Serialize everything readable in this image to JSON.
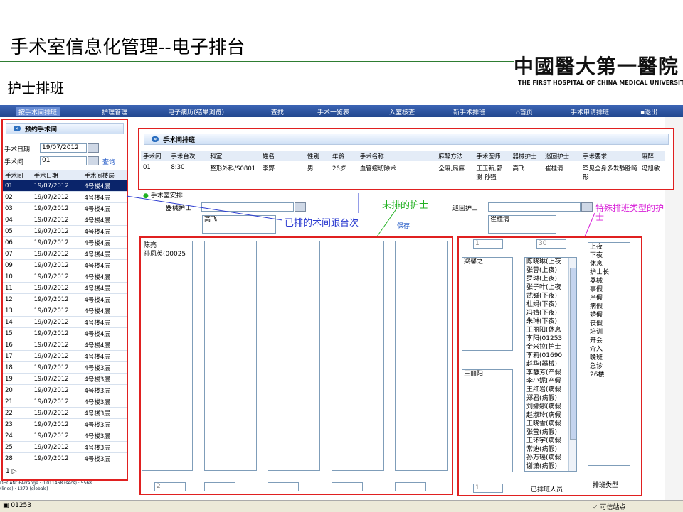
{
  "slide": {
    "title": "手术室信息化管理--电子排台",
    "subtitle": "护士排班",
    "logo_cn": "中國醫大第一醫院",
    "logo_en": "THE FIRST HOSPITAL OF CHINA MEDICAL UNIVERSITY"
  },
  "menu": [
    "按手术间排班",
    "护理管理",
    "电子病历(结果浏览)",
    "查找",
    "手术一览表",
    "入室核查",
    "新手术排班",
    "首页",
    "手术申请排班",
    "退出"
  ],
  "left": {
    "title": "预约手术间",
    "date_label": "手术日期",
    "date_value": "19/07/2012",
    "room_label": "手术间",
    "room_value": "01",
    "query": "查询",
    "headers": [
      "手术间",
      "手术日期",
      "手术间楼层"
    ],
    "rows": [
      [
        "01",
        "19/07/2012",
        "4号楼4层"
      ],
      [
        "02",
        "19/07/2012",
        "4号楼4层"
      ],
      [
        "03",
        "19/07/2012",
        "4号楼4层"
      ],
      [
        "04",
        "19/07/2012",
        "4号楼4层"
      ],
      [
        "05",
        "19/07/2012",
        "4号楼4层"
      ],
      [
        "06",
        "19/07/2012",
        "4号楼4层"
      ],
      [
        "07",
        "19/07/2012",
        "4号楼4层"
      ],
      [
        "09",
        "19/07/2012",
        "4号楼4层"
      ],
      [
        "10",
        "19/07/2012",
        "4号楼4层"
      ],
      [
        "11",
        "19/07/2012",
        "4号楼4层"
      ],
      [
        "12",
        "19/07/2012",
        "4号楼4层"
      ],
      [
        "13",
        "19/07/2012",
        "4号楼4层"
      ],
      [
        "14",
        "19/07/2012",
        "4号楼4层"
      ],
      [
        "15",
        "19/07/2012",
        "4号楼4层"
      ],
      [
        "16",
        "19/07/2012",
        "4号楼4层"
      ],
      [
        "17",
        "19/07/2012",
        "4号楼4层"
      ],
      [
        "18",
        "19/07/2012",
        "4号楼3层"
      ],
      [
        "19",
        "19/07/2012",
        "4号楼3层"
      ],
      [
        "20",
        "19/07/2012",
        "4号楼3层"
      ],
      [
        "21",
        "19/07/2012",
        "4号楼3层"
      ],
      [
        "22",
        "19/07/2012",
        "4号楼3层"
      ],
      [
        "23",
        "19/07/2012",
        "4号楼3层"
      ],
      [
        "24",
        "19/07/2012",
        "4号楼3层"
      ],
      [
        "25",
        "19/07/2012",
        "4号楼3层"
      ],
      [
        "28",
        "19/07/2012",
        "4号楼3层"
      ]
    ],
    "pager": "1",
    "debug_line1": "DHCANOPArrange · 0.011468 (secs) · 5568",
    "debug_line2": "(lines) · 1279 (globals)"
  },
  "top": {
    "title": "手术间排班",
    "headers": [
      "手术间",
      "手术台次",
      "科室",
      "姓名",
      "性别",
      "年龄",
      "手术名称",
      "麻醉方法",
      "手术医师",
      "器械护士",
      "巡回护士",
      "手术要求",
      "麻醉"
    ],
    "row": [
      "01",
      "8:30",
      "整形外科/S0801",
      "李野",
      "男",
      "26岁",
      "血管瘤切除术",
      "全麻,局麻",
      "王玉新,郭澍 孙强",
      "高飞",
      "崔桂清",
      "罕见全身多发静脉畸形",
      "冯旭敏"
    ]
  },
  "arrange": {
    "section": "手术室安排",
    "instrument_label": "器械护士",
    "instrument_value": "高飞",
    "circulating_label": "巡回护士",
    "circulating_value": "崔桂清",
    "save": "保存",
    "col1_items": [
      "陈亮",
      "孙凤英(00025"
    ],
    "count_left": "2"
  },
  "special": {
    "count_a": "1",
    "count_b": "30",
    "box1": [
      "梁馨之"
    ],
    "box2": [
      "王丽阳"
    ],
    "count_c": "1",
    "scheduled_list": [
      "陈晓琳(上夜",
      "张蓉(上夜)",
      "罗琳(上夜)",
      "张子叶(上夜",
      "武巍(下夜)",
      "杜娟(下夜)",
      "冯婧(下夜)",
      "朱琳(下夜)",
      "王丽阳(休息",
      "李阳(01253",
      "金米拉(护士",
      "李莉(01690",
      "赵华(器械)",
      "李静芳(产假",
      "李小妮(产假",
      "王红岩(病假",
      "郑君(病假)",
      "刘娜娜(病假",
      "赵淑玲(病假",
      "王晓雪(病假",
      "张莹(病假)",
      "王环宇(病假",
      "常迪(病假)",
      "孙万瑶(病假",
      "谢潇(病假)"
    ],
    "scheduled_label": "已排班人员",
    "types": [
      "上夜",
      "下夜",
      "休息",
      "护士长",
      "器械",
      "事假",
      "产假",
      "病假",
      "婚假",
      "丧假",
      "培训",
      "开会",
      "介入",
      "晚班",
      "急诊",
      "26楼"
    ],
    "types_label": "排班类型"
  },
  "annotations": {
    "scheduled_room": "已排的术间跟台次",
    "unscheduled": "未排的护士",
    "special_type_1": "特殊排班类型的护",
    "special_type_2": "士"
  },
  "status": {
    "left": "01253",
    "right": "可信站点"
  },
  "colors": {
    "highlight": "#e02020",
    "menubar": "#2c4f9e",
    "selected_row": "#0a246a"
  }
}
